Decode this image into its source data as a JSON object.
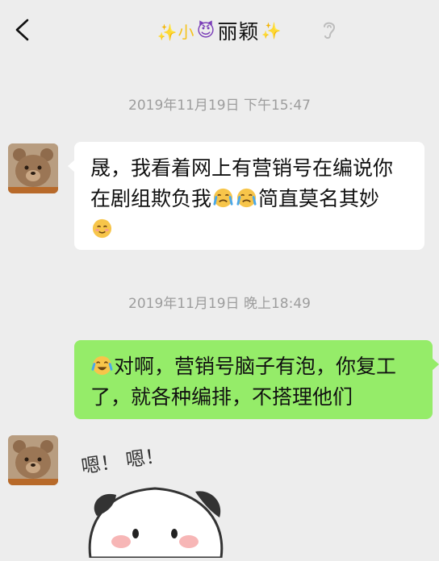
{
  "header": {
    "title_prefix": "✨小",
    "title_emoji": "😈",
    "title_name": "丽颖",
    "title_suffix": "✨"
  },
  "messages": [
    {
      "type": "time",
      "text": "2019年11月19日 下午15:47"
    },
    {
      "type": "incoming",
      "part1": "晟，我看着网上有营销号在编说你在剧组欺负我",
      "part2": "简直莫名其妙",
      "emojis": [
        "crying-face",
        "crying-face",
        "smile-face"
      ]
    },
    {
      "type": "time",
      "text": "2019年11月19日 晚上18:49"
    },
    {
      "type": "outgoing",
      "text": "对啊，营销号脑子有泡，你复工了，就各种编排，不搭理他们",
      "emojis": [
        "tears-of-joy-face"
      ]
    },
    {
      "type": "sticker",
      "text": "嗯！ 嗯！"
    }
  ],
  "colors": {
    "background": "#ededed",
    "incoming_bubble": "#ffffff",
    "outgoing_bubble": "#95ec69",
    "timestamp": "#9d9d9d"
  }
}
